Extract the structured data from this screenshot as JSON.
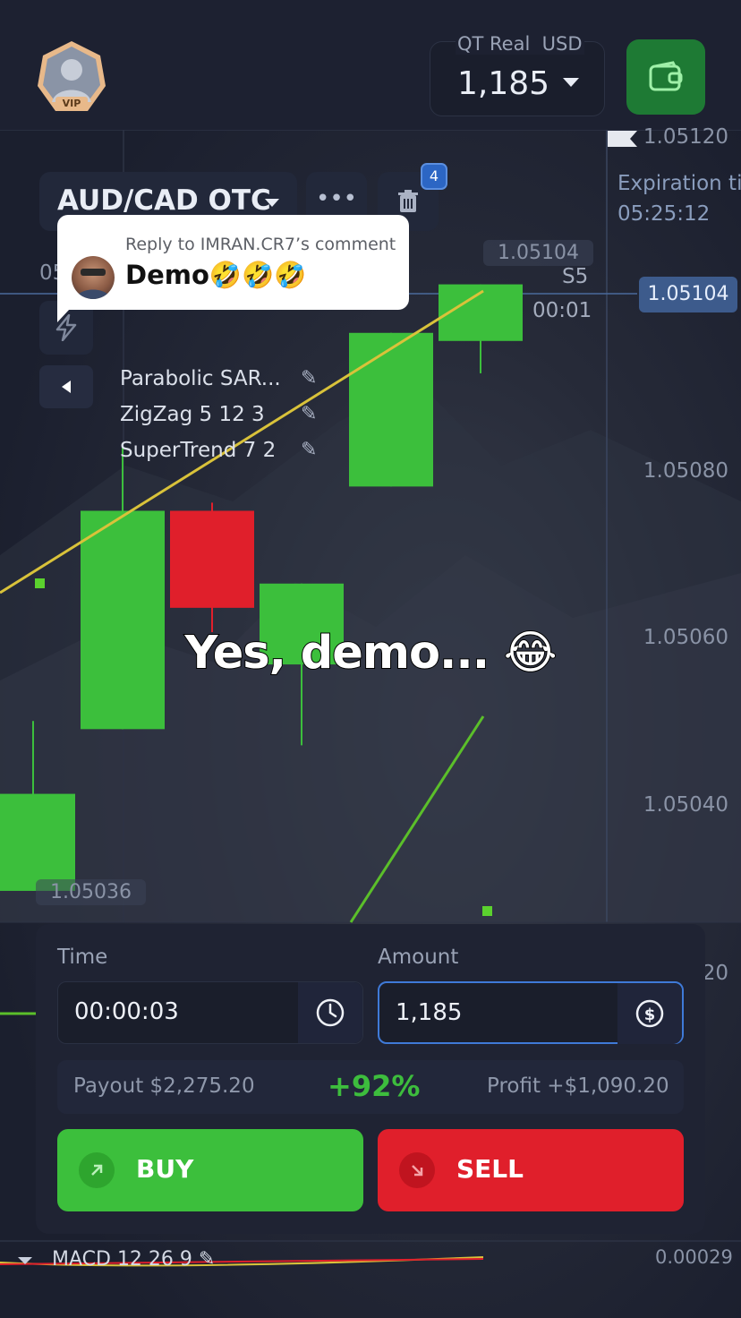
{
  "header": {
    "avatar_badge": "VIP",
    "account_label": "QT Real",
    "currency": "USD",
    "balance": "1,185"
  },
  "chart": {
    "price_labels": [
      "1.05120",
      "1.05080",
      "1.05060",
      "1.05040",
      "20"
    ],
    "expiration_label": "Expiration ti",
    "expiration_time": "05:25:12",
    "current_price": "1.05104",
    "high_line_value": "1.05104",
    "timeframe": "S5",
    "countdown": "00:01",
    "low_line_value": "1.05036",
    "left_partial_time": "05"
  },
  "toolbar": {
    "pair": "AUD/CAD OTC",
    "more_label": "•••",
    "badge_count": "4"
  },
  "comment": {
    "reply_to": "Reply to IMRAN.CR7’s comment",
    "text": "Demo🤣🤣🤣"
  },
  "indicators": [
    {
      "label": "Parabolic SAR..."
    },
    {
      "label": "ZigZag 5 12 3"
    },
    {
      "label": "SuperTrend 7 2"
    }
  ],
  "caption": "Yes, demo... 😂",
  "trade": {
    "time_label": "Time",
    "time_value": "00:00:03",
    "amount_label": "Amount",
    "amount_value": "1,185",
    "payout_label": "Payout  $2,275.20",
    "payout_percent": "+92%",
    "profit_label": "Profit  +$1,090.20",
    "buy_label": "BUY",
    "sell_label": "SELL"
  },
  "macd": {
    "label": "MACD  12 26 9",
    "value": "0.00029"
  },
  "colors": {
    "bull": "#3cbf3c",
    "bear": "#e01f2b",
    "trendline": "#d9c23a",
    "accent_blue": "#3f7ad8"
  },
  "chart_data": {
    "type": "candlestick",
    "pair": "AUD/CAD OTC",
    "timeframe": "S5",
    "candles": [
      {
        "open": 1.05029,
        "close": 1.05041,
        "high": 1.0505,
        "low": 1.05029,
        "direction": "up"
      },
      {
        "open": 1.05049,
        "close": 1.05076,
        "high": 1.05084,
        "low": 1.05049,
        "direction": "up"
      },
      {
        "open": 1.05076,
        "close": 1.05064,
        "high": 1.05077,
        "low": 1.05061,
        "direction": "down"
      },
      {
        "open": 1.05057,
        "close": 1.05067,
        "high": 1.05067,
        "low": 1.05047,
        "direction": "up"
      },
      {
        "open": 1.05079,
        "close": 1.05098,
        "high": 1.05098,
        "low": 1.05079,
        "direction": "up"
      },
      {
        "open": 1.05097,
        "close": 1.05104,
        "high": 1.05104,
        "low": 1.05093,
        "direction": "up"
      }
    ],
    "ylim": [
      1.05028,
      1.05122
    ],
    "current_price": 1.05104
  }
}
